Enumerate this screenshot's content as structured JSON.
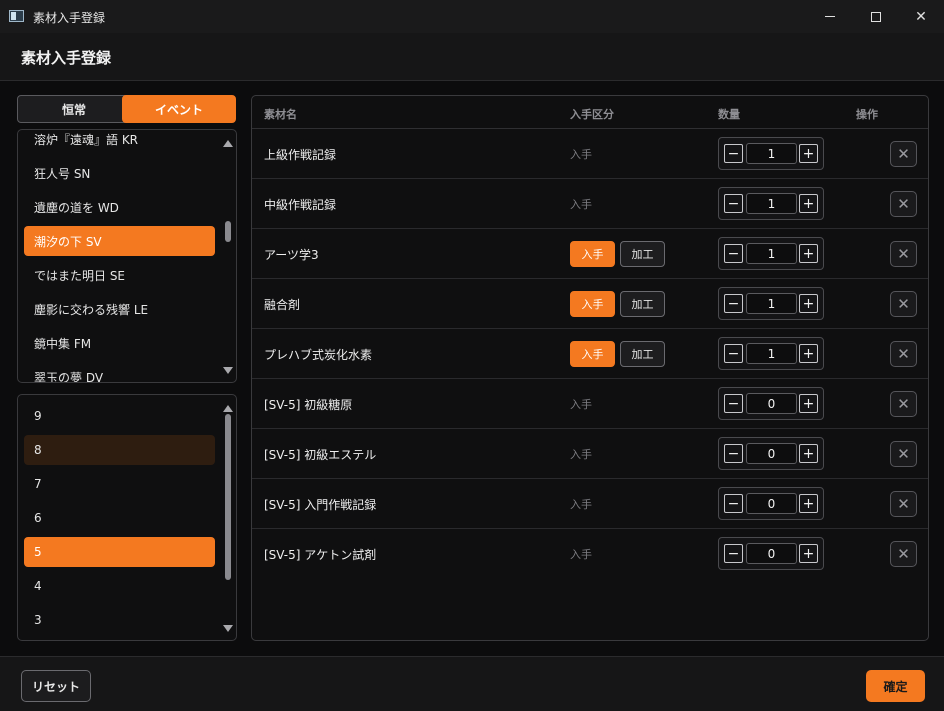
{
  "window": {
    "title": "素材入手登録",
    "minimize": "—",
    "maximize": "□",
    "close": "✕"
  },
  "header": {
    "title": "素材入手登録"
  },
  "tabs": [
    {
      "label": "恒常",
      "active": false
    },
    {
      "label": "イベント",
      "active": true
    }
  ],
  "events": [
    {
      "label": "溶炉『遠魂』語 KR"
    },
    {
      "label": "狂人号 SN"
    },
    {
      "label": "遺塵の道を WD"
    },
    {
      "label": "潮汐の下 SV",
      "selected": true
    },
    {
      "label": "ではまた明日 SE"
    },
    {
      "label": "塵影に交わる残響 LE"
    },
    {
      "label": "鏡中集 FM"
    },
    {
      "label": "翠玉の夢 DV"
    }
  ],
  "stages": [
    {
      "label": "9"
    },
    {
      "label": "8",
      "hover": true
    },
    {
      "label": "7"
    },
    {
      "label": "6"
    },
    {
      "label": "5",
      "selected": true
    },
    {
      "label": "4"
    },
    {
      "label": "3"
    }
  ],
  "table": {
    "columns": {
      "name": "素材名",
      "type": "入手区分",
      "qty": "数量",
      "ops": "操作"
    },
    "acquire_label": "入手",
    "process_label": "加工",
    "minus": "−",
    "plus": "+",
    "delete": "✕",
    "rows": [
      {
        "name": "上級作戦記録",
        "type": "入手",
        "toggle": false,
        "qty": "1"
      },
      {
        "name": "中級作戦記録",
        "type": "入手",
        "toggle": false,
        "qty": "1"
      },
      {
        "name": "アーツ学3",
        "type": "入手",
        "toggle": true,
        "qty": "1"
      },
      {
        "name": "融合剤",
        "type": "入手",
        "toggle": true,
        "qty": "1"
      },
      {
        "name": "プレハブ式炭化水素",
        "type": "入手",
        "toggle": true,
        "qty": "1"
      },
      {
        "name": "[SV-5] 初級糖原",
        "type": "入手",
        "toggle": false,
        "qty": "0"
      },
      {
        "name": "[SV-5] 初級エステル",
        "type": "入手",
        "toggle": false,
        "qty": "0"
      },
      {
        "name": "[SV-5] 入門作戦記録",
        "type": "入手",
        "toggle": false,
        "qty": "0"
      },
      {
        "name": "[SV-5] アケトン試剤",
        "type": "入手",
        "toggle": false,
        "qty": "0"
      }
    ]
  },
  "footer": {
    "reset": "リセット",
    "confirm": "確定"
  },
  "colors": {
    "accent": "#f47920",
    "background": "#0c0c0d"
  }
}
